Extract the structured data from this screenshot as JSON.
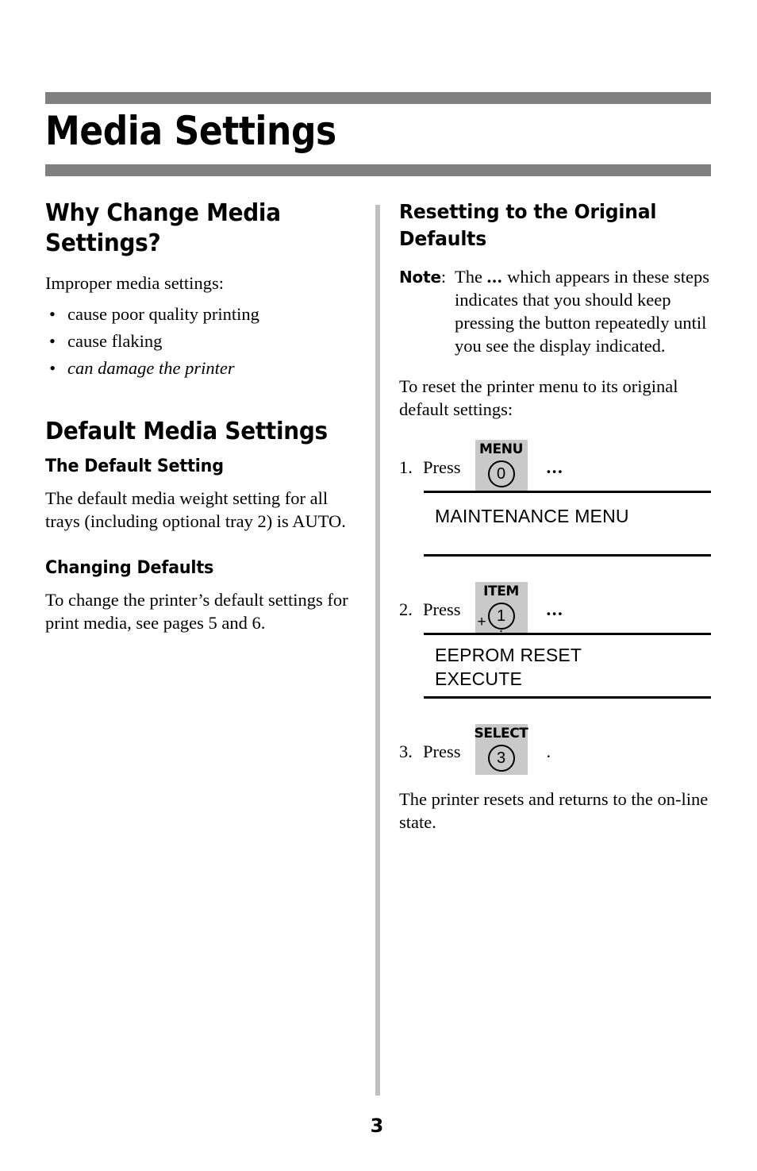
{
  "page": {
    "title": "Media Settings",
    "number": "3",
    "accent_bar_color": "#808080",
    "divider_color": "#c0c0c0",
    "keycap_fill_color": "#c9c9c9"
  },
  "left_column": {
    "heading": {
      "line1": "Why Change Media",
      "line2": "Settings?"
    },
    "intro": "Improper media settings:",
    "bullet_marker": "•",
    "bullets": [
      "cause poor quality printing",
      "cause flaking",
      "can damage the printer"
    ],
    "section2": {
      "heading": "Default Media Settings",
      "sub1": {
        "heading": "The Default Setting",
        "body": "The default media weight setting for all trays (including optional tray 2) is AUTO."
      },
      "sub2": {
        "heading": "Changing Defaults",
        "body": "To change the printer’s default settings for print media, see pages 5 and 6."
      }
    }
  },
  "right_column": {
    "heading": {
      "line1": "Resetting to the Original",
      "line2": "Defaults"
    },
    "note": {
      "label": "Note",
      "colon": ":",
      "text_before_ellipsis": "The ",
      "ellipsis": "...",
      "text_after_ellipsis": " which appears in these steps indicates that you should keep pressing the button repeatedly until you see the display indicated."
    },
    "intro": "To reset the printer menu to its original default settings:",
    "steps": [
      {
        "number": "1.",
        "verb": "Press",
        "key": {
          "label": "MENU",
          "digit": "0",
          "plus": "",
          "tick": ""
        },
        "trailing": "...",
        "trailing_kind": "ellipsis",
        "display_lines": [
          "MAINTENANCE MENU"
        ]
      },
      {
        "number": "2.",
        "verb": "Press",
        "key": {
          "label": "ITEM",
          "digit": "1",
          "plus": "+",
          "tick": "."
        },
        "trailing": "...",
        "trailing_kind": "ellipsis",
        "display_lines": [
          "EEPROM RESET",
          "EXECUTE"
        ]
      },
      {
        "number": "3.",
        "verb": "Press",
        "key": {
          "label": "SELECT",
          "digit": "3",
          "plus": "",
          "tick": ""
        },
        "trailing": ".",
        "trailing_kind": "period",
        "display_lines": []
      }
    ],
    "closing": "The printer resets and returns to the on-line state."
  }
}
